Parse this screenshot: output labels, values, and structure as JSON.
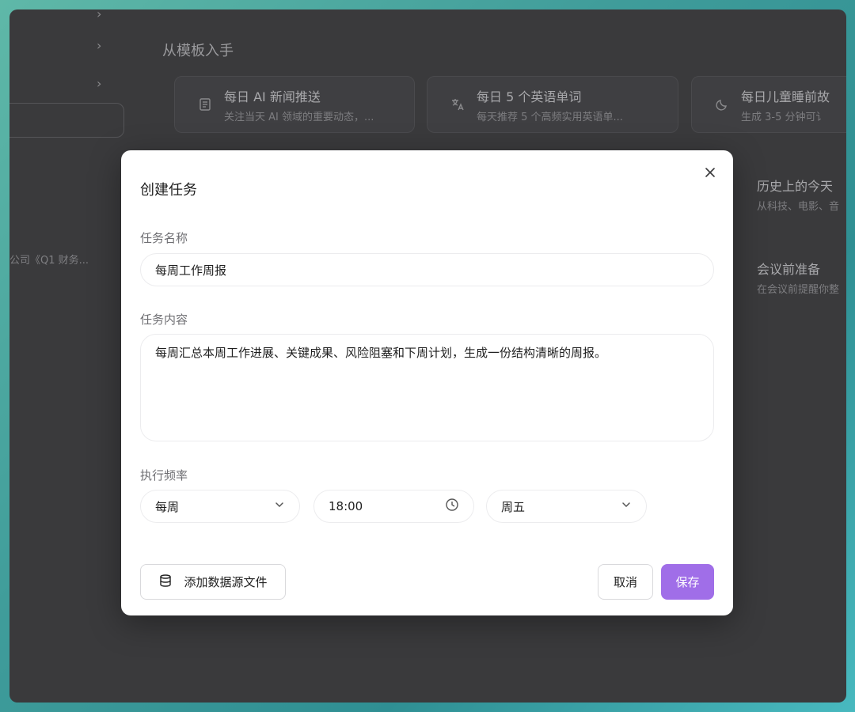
{
  "background": {
    "section_title": "从模板入手",
    "recent_item": "公司《Q1 财务...",
    "templates": [
      {
        "title": "每日 AI 新闻推送",
        "desc": "关注当天 AI 领域的重要动态，..."
      },
      {
        "title": "每日 5 个英语单词",
        "desc": "每天推荐 5 个高频实用英语单..."
      },
      {
        "title": "每日儿童睡前故",
        "desc": "生成 3-5 分钟可讠"
      },
      {
        "title": "历史上的今天",
        "desc": "从科技、电影、音"
      },
      {
        "title": "会议前准备",
        "desc": "在会议前提醒你整"
      }
    ]
  },
  "modal": {
    "title": "创建任务",
    "name_label": "任务名称",
    "name_value": "每周工作周报",
    "content_label": "任务内容",
    "content_value": "每周汇总本周工作进展、关键成果、风险阻塞和下周计划，生成一份结构清晰的周报。",
    "frequency_label": "执行频率",
    "frequency_value": "每周",
    "time_value": "18:00",
    "weekday_value": "周五",
    "add_source_label": "添加数据源文件",
    "cancel_label": "取消",
    "save_label": "保存"
  },
  "colors": {
    "accent": "#a06ee8",
    "overlay": "#3a3a3c"
  }
}
